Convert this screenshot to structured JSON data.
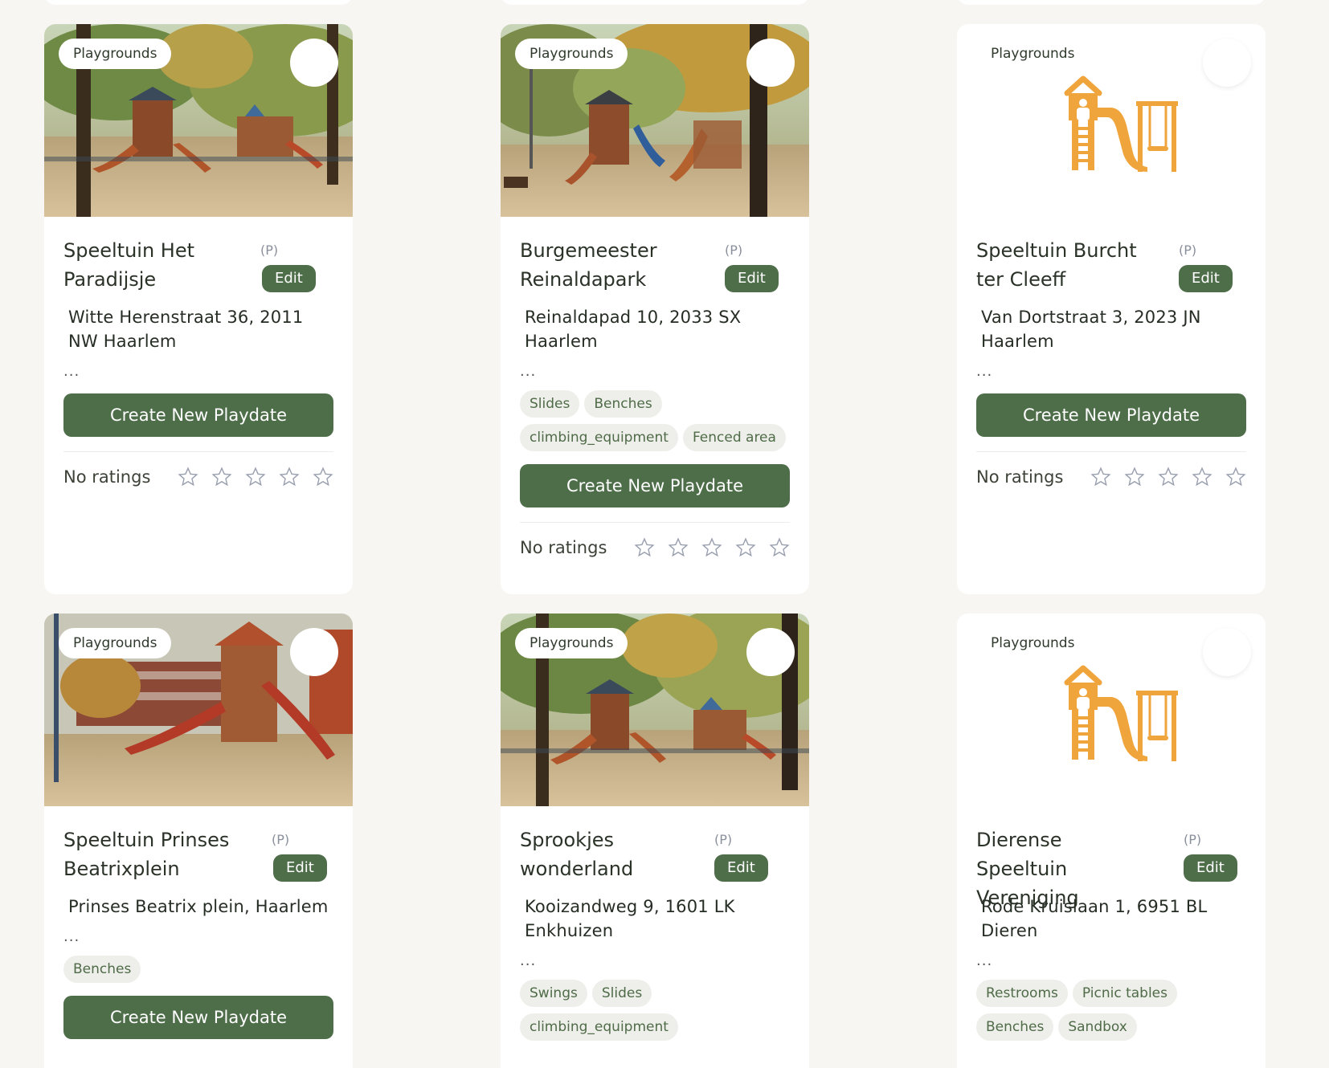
{
  "cards": [
    {
      "category": "Playgrounds",
      "title": "Speeltuin Het Paradijsje",
      "private_marker": "(P)",
      "edit_label": "Edit",
      "address": "Witte Herenstraat 36, 2011 NW Haarlem",
      "ellipsis": "...",
      "tags": [],
      "cta_label": "Create New Playdate",
      "rating_label": "No ratings",
      "image": "playground-photo"
    },
    {
      "category": "Playgrounds",
      "title": "Burgemeester Reinaldapark",
      "private_marker": "(P)",
      "edit_label": "Edit",
      "address": "Reinaldapad 10, 2033 SX Haarlem",
      "ellipsis": "...",
      "tags": [
        "Slides",
        "Benches",
        "climbing_equipment",
        "Fenced area"
      ],
      "cta_label": "Create New Playdate",
      "rating_label": "No ratings",
      "image": "playground-photo"
    },
    {
      "category": "Playgrounds",
      "title": "Speeltuin Burcht ter Cleeff",
      "private_marker": "(P)",
      "edit_label": "Edit",
      "address": "Van Dortstraat 3, 2023 JN Haarlem",
      "ellipsis": "...",
      "tags": [],
      "cta_label": "Create New Playdate",
      "rating_label": "No ratings",
      "image": "playground-illustration-icon"
    },
    {
      "category": "Playgrounds",
      "title": "Speeltuin Prinses Beatrixplein",
      "private_marker": "(P)",
      "edit_label": "Edit",
      "address": "Prinses Beatrix plein, Haarlem",
      "ellipsis": "...",
      "tags": [
        "Benches"
      ],
      "cta_label": "Create New Playdate",
      "rating_label": "",
      "image": "playground-photo"
    },
    {
      "category": "Playgrounds",
      "title": "Sprookjes wonderland",
      "private_marker": "(P)",
      "edit_label": "Edit",
      "address": "Kooizandweg 9, 1601 LK Enkhuizen",
      "ellipsis": "...",
      "tags": [
        "Swings",
        "Slides",
        "climbing_equipment"
      ],
      "cta_label": "",
      "rating_label": "",
      "image": "playground-photo"
    },
    {
      "category": "Playgrounds",
      "title": "Dierense Speeltuin Vereniging",
      "private_marker": "(P)",
      "edit_label": "Edit",
      "address": "Rode Kruislaan 1, 6951 BL Dieren",
      "ellipsis": "...",
      "tags": [
        "Restrooms",
        "Picnic tables",
        "Benches",
        "Sandbox"
      ],
      "cta_label": "",
      "rating_label": "",
      "image": "playground-illustration-icon"
    }
  ],
  "colors": {
    "accent": "#4e6e4a",
    "page_background": "#f7f6f2",
    "illustration": "#f0a53c",
    "star_outline": "#9aa0b0"
  },
  "icons": {
    "favorite": "favorite-button",
    "rating": "star-icon"
  }
}
